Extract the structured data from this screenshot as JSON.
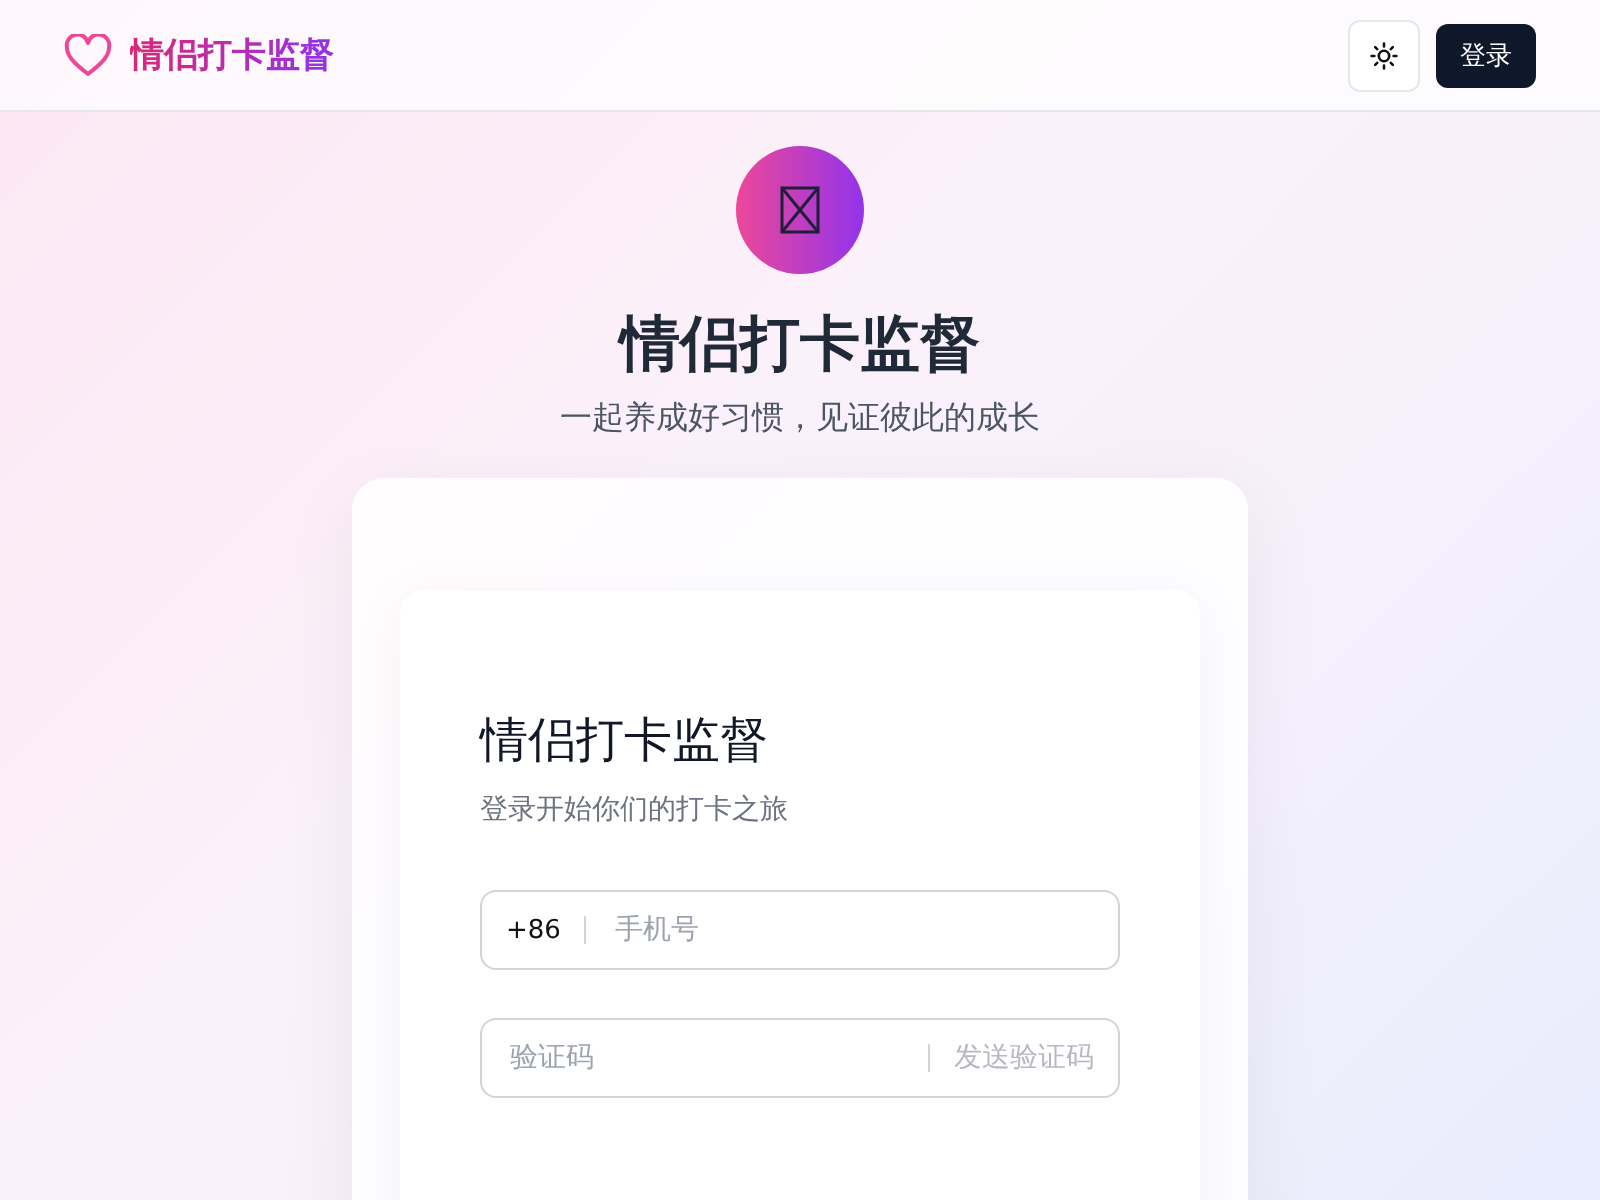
{
  "header": {
    "app_name": "情侣打卡监督",
    "login_button": "登录"
  },
  "hero": {
    "title": "情侣打卡监督",
    "subtitle": "一起养成好习惯，见证彼此的成长"
  },
  "login_card": {
    "title": "情侣打卡监督",
    "subtitle": "登录开始你们的打卡之旅",
    "phone_field": {
      "prefix": "+86",
      "placeholder": "手机号"
    },
    "code_field": {
      "placeholder": "验证码",
      "send_button": {
        "label": "发送验证码",
        "disabled": true
      }
    }
  }
}
